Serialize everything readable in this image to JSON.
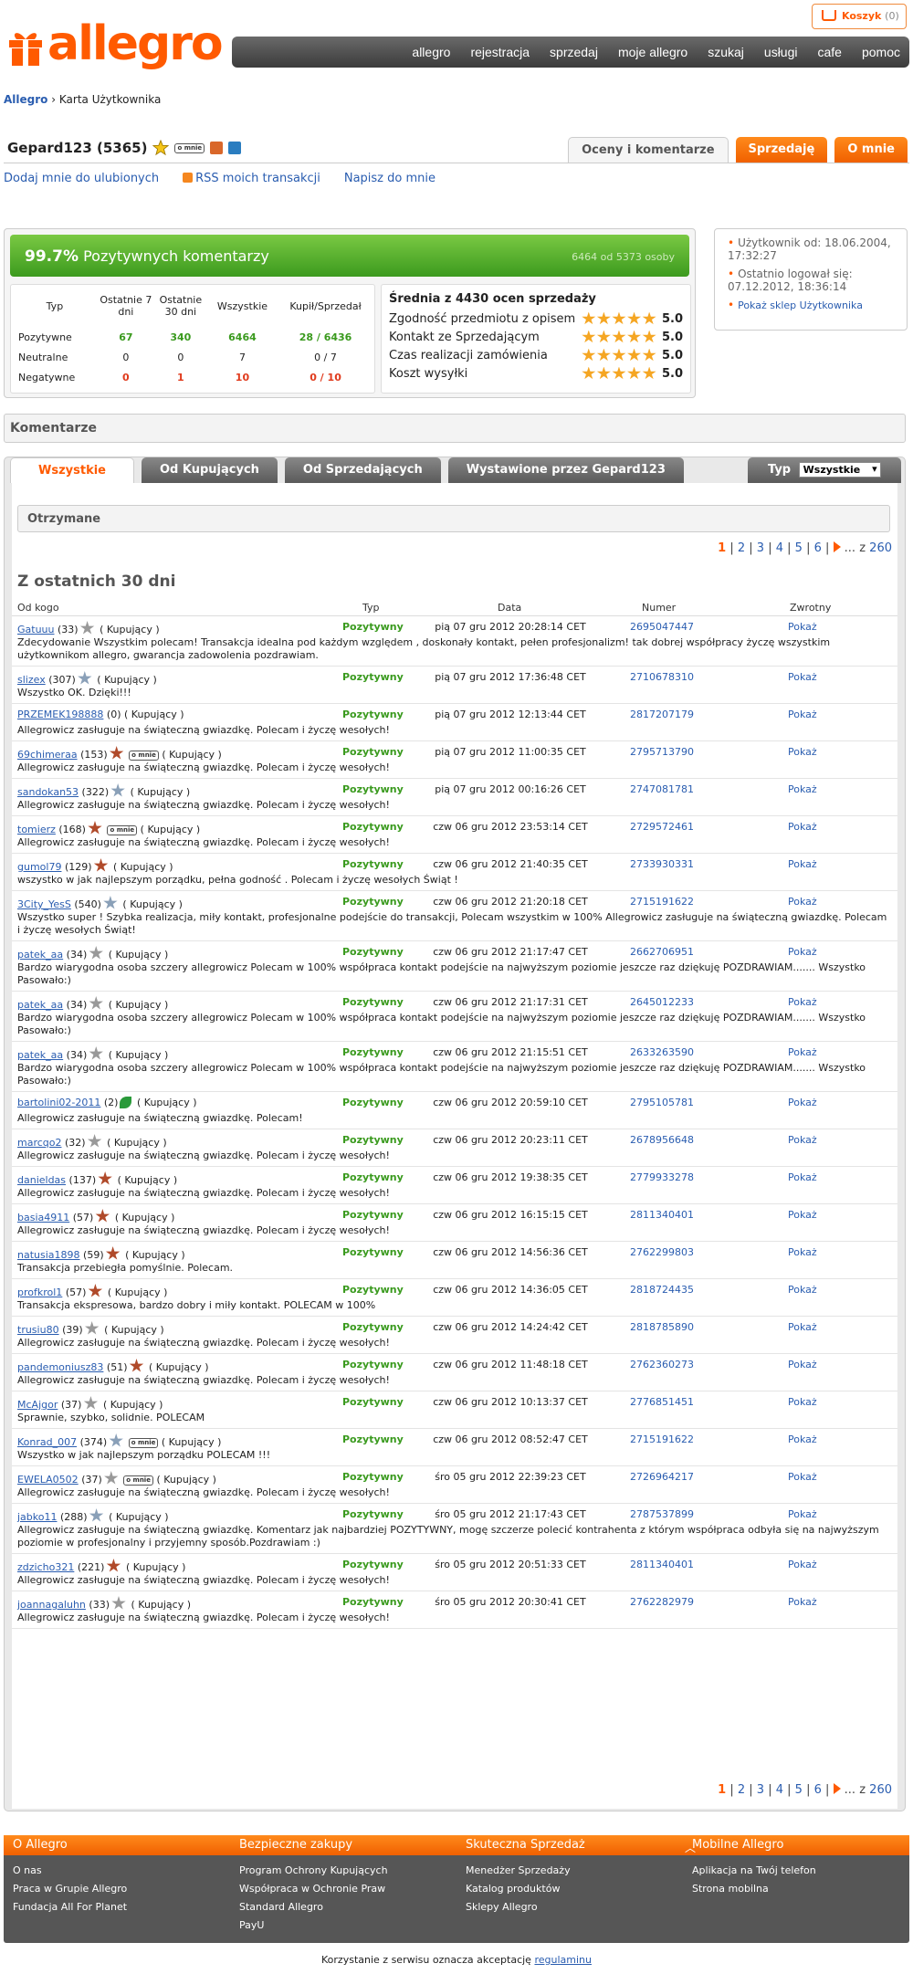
{
  "header": {
    "logo_text": "allegro",
    "cart_label": "Koszyk",
    "cart_count": "(0)",
    "nav": [
      "allegro",
      "rejestracja",
      "sprzedaj",
      "moje allegro",
      "szukaj",
      "usługi",
      "cafe",
      "pomoc"
    ]
  },
  "breadcrumb": {
    "root": "Allegro",
    "sep": "›",
    "current": "Karta Użytkownika"
  },
  "user": {
    "name": "Gepard123 (5365)",
    "omnie_badge": "o mnie"
  },
  "profile_tabs": [
    "Oceny i komentarze",
    "Sprzedaję",
    "O mnie"
  ],
  "links": {
    "fav": "Dodaj mnie do ulubionych",
    "rss": "RSS moich transakcji",
    "write": "Napisz do mnie"
  },
  "rating": {
    "percent": "99.7%",
    "label": "Pozytywnych komentarzy",
    "count_text": "6464 od 5373 osoby",
    "headers": [
      "Typ",
      "Ostatnie 7 dni",
      "Ostatnie 30 dni",
      "Wszystkie",
      "Kupił/Sprzedał"
    ],
    "rows": [
      {
        "type": "Pozytywne",
        "d7": "67",
        "d30": "340",
        "all": "6464",
        "ks": "28 / 6436",
        "cls": "g"
      },
      {
        "type": "Neutralne",
        "d7": "0",
        "d30": "0",
        "all": "7",
        "ks": "0 / 7",
        "cls": ""
      },
      {
        "type": "Negatywne",
        "d7": "0",
        "d30": "1",
        "all": "10",
        "ks": "0 / 10",
        "cls": "r"
      }
    ],
    "avg_title": "Średnia z 4430 ocen sprzedaży",
    "avg": [
      {
        "label": "Zgodność przedmiotu z opisem",
        "value": "5.0"
      },
      {
        "label": "Kontakt ze Sprzedającym",
        "value": "5.0"
      },
      {
        "label": "Czas realizacji zamówienia",
        "value": "5.0"
      },
      {
        "label": "Koszt wysyłki",
        "value": "5.0"
      }
    ],
    "star_color": "#f5a623",
    "green": "#5ab22f"
  },
  "sidebox": {
    "since": "Użytkownik od: 18.06.2004, 17:32:27",
    "lastlogin": "Ostatnio logował się: 07.12.2012, 18:36:14",
    "shop": "Pokaż sklep Użytkownika"
  },
  "comments": {
    "section_title": "Komentarze",
    "tabs": [
      "Wszystkie",
      "Od Kupujących",
      "Od Sprzedających",
      "Wystawione przez Gepard123"
    ],
    "typ_label": "Typ",
    "typ_value": "Wszystkie",
    "subheader": "Otrzymane",
    "pager": {
      "pages": [
        "1",
        "2",
        "3",
        "4",
        "5",
        "6"
      ],
      "dots": "... z",
      "last": "260"
    },
    "period_title": "Z ostatnich 30 dni",
    "columns": [
      "Od kogo",
      "Typ",
      "Data",
      "Numer",
      "Zwrotny"
    ],
    "items": [
      {
        "user": "Gatuuu",
        "score": "(33)",
        "star": "empty",
        "omnie": false,
        "role": "( Kupujący )",
        "type": "Pozytywny",
        "date": "pią 07 gru 2012 20:28:14 CET",
        "num": "2695047447",
        "zw": "Pokaż",
        "text": "Zdecydowanie Wszystkim polecam! Transakcja idealna pod każdym względem , doskonały kontakt, pełen profesjonalizm! tak dobrej współpracy życzę wszystkim użytkownikom allegro, gwarancja zadowolenia pozdrawiam."
      },
      {
        "user": "slizex",
        "score": "(307)",
        "star": "gray",
        "omnie": false,
        "role": "( Kupujący )",
        "type": "Pozytywny",
        "date": "pią 07 gru 2012 17:36:48 CET",
        "num": "2710678310",
        "zw": "Pokaż",
        "text": "Wszystko OK. Dzięki!!!"
      },
      {
        "user": "PRZEMEK198888",
        "score": "(0)",
        "star": "none",
        "omnie": false,
        "role": "( Kupujący )",
        "type": "Pozytywny",
        "date": "pią 07 gru 2012 12:13:44 CET",
        "num": "2817207179",
        "zw": "Pokaż",
        "text": "Allegrowicz zasługuje na świąteczną gwiazdkę. Polecam i życzę wesołych!"
      },
      {
        "user": "69chimeraa",
        "score": "(153)",
        "star": "red",
        "omnie": true,
        "role": "( Kupujący )",
        "type": "Pozytywny",
        "date": "pią 07 gru 2012 11:00:35 CET",
        "num": "2795713790",
        "zw": "Pokaż",
        "text": "Allegrowicz zasługuje na świąteczną gwiazdkę. Polecam i życzę wesołych!"
      },
      {
        "user": "sandokan53",
        "score": "(322)",
        "star": "gray",
        "omnie": false,
        "role": "( Kupujący )",
        "type": "Pozytywny",
        "date": "pią 07 gru 2012 00:16:26 CET",
        "num": "2747081781",
        "zw": "Pokaż",
        "text": "Allegrowicz zasługuje na świąteczną gwiazdkę. Polecam i życzę wesołych!"
      },
      {
        "user": "tomierz",
        "score": "(168)",
        "star": "red",
        "omnie": true,
        "role": "( Kupujący )",
        "type": "Pozytywny",
        "date": "czw 06 gru 2012 23:53:14 CET",
        "num": "2729572461",
        "zw": "Pokaż",
        "text": "Allegrowicz zasługuje na świąteczną gwiazdkę. Polecam i życzę wesołych!"
      },
      {
        "user": "gumol79",
        "score": "(129)",
        "star": "red",
        "omnie": false,
        "role": "( Kupujący )",
        "type": "Pozytywny",
        "date": "czw 06 gru 2012 21:40:35 CET",
        "num": "2733930331",
        "zw": "Pokaż",
        "text": "wszystko w jak najlepszym porządku, pełna godność . Polecam i życzę wesołych Świąt !"
      },
      {
        "user": "3City_YesS",
        "score": "(540)",
        "star": "gray",
        "omnie": false,
        "role": "( Kupujący )",
        "type": "Pozytywny",
        "date": "czw 06 gru 2012 21:20:18 CET",
        "num": "2715191622",
        "zw": "Pokaż",
        "text": "Wszystko super ! Szybka realizacja, miły kontakt, profesjonalne podejście do transakcji, Polecam wszystkim w 100% Allegrowicz zasługuje na świąteczną gwiazdkę. Polecam i życzę wesołych Świąt!"
      },
      {
        "user": "patek_aa",
        "score": "(34)",
        "star": "empty",
        "omnie": false,
        "role": "( Kupujący )",
        "type": "Pozytywny",
        "date": "czw 06 gru 2012 21:17:47 CET",
        "num": "2662706951",
        "zw": "Pokaż",
        "text": "Bardzo wiarygodna osoba szczery allegrowicz Polecam w 100% współpraca kontakt podejście na najwyższym poziomie jeszcze raz dziękuję POZDRAWIAM....... Wszystko Pasowało:)"
      },
      {
        "user": "patek_aa",
        "score": "(34)",
        "star": "empty",
        "omnie": false,
        "role": "( Kupujący )",
        "type": "Pozytywny",
        "date": "czw 06 gru 2012 21:17:31 CET",
        "num": "2645012233",
        "zw": "Pokaż",
        "text": "Bardzo wiarygodna osoba szczery allegrowicz Polecam w 100% współpraca kontakt podejście na najwyższym poziomie jeszcze raz dziękuję POZDRAWIAM....... Wszystko Pasowało:)"
      },
      {
        "user": "patek_aa",
        "score": "(34)",
        "star": "empty",
        "omnie": false,
        "role": "( Kupujący )",
        "type": "Pozytywny",
        "date": "czw 06 gru 2012 21:15:51 CET",
        "num": "2633263590",
        "zw": "Pokaż",
        "text": "Bardzo wiarygodna osoba szczery allegrowicz Polecam w 100% współpraca kontakt podejście na najwyższym poziomie jeszcze raz dziękuję POZDRAWIAM....... Wszystko Pasowało:)"
      },
      {
        "user": "bartolini02-2011",
        "score": "(2)",
        "star": "leaf",
        "omnie": false,
        "role": "( Kupujący )",
        "type": "Pozytywny",
        "date": "czw 06 gru 2012 20:59:10 CET",
        "num": "2795105781",
        "zw": "Pokaż",
        "text": "Allegrowicz zasługuje na świąteczną gwiazdkę. Polecam!"
      },
      {
        "user": "marcqo2",
        "score": "(32)",
        "star": "empty",
        "omnie": false,
        "role": "( Kupujący )",
        "type": "Pozytywny",
        "date": "czw 06 gru 2012 20:23:11 CET",
        "num": "2678956648",
        "zw": "Pokaż",
        "text": "Allegrowicz zasługuje na świąteczną gwiazdkę. Polecam i życzę wesołych!"
      },
      {
        "user": "danieldas",
        "score": "(137)",
        "star": "red",
        "omnie": false,
        "role": "( Kupujący )",
        "type": "Pozytywny",
        "date": "czw 06 gru 2012 19:38:35 CET",
        "num": "2779933278",
        "zw": "Pokaż",
        "text": "Allegrowicz zasługuje na świąteczną gwiazdkę. Polecam i życzę wesołych!"
      },
      {
        "user": "basia4911",
        "score": "(57)",
        "star": "red",
        "omnie": false,
        "role": "( Kupujący )",
        "type": "Pozytywny",
        "date": "czw 06 gru 2012 16:15:15 CET",
        "num": "2811340401",
        "zw": "Pokaż",
        "text": "Allegrowicz zasługuje na świąteczną gwiazdkę. Polecam i życzę wesołych!"
      },
      {
        "user": "natusia1898",
        "score": "(59)",
        "star": "red",
        "omnie": false,
        "role": "( Kupujący )",
        "type": "Pozytywny",
        "date": "czw 06 gru 2012 14:56:36 CET",
        "num": "2762299803",
        "zw": "Pokaż",
        "text": "Transakcja przebiegła pomyślnie. Polecam."
      },
      {
        "user": "profkrol1",
        "score": "(57)",
        "star": "red",
        "omnie": false,
        "role": "( Kupujący )",
        "type": "Pozytywny",
        "date": "czw 06 gru 2012 14:36:05 CET",
        "num": "2818724435",
        "zw": "Pokaż",
        "text": "Transakcja ekspresowa, bardzo dobry i miły kontakt. POLECAM w 100%"
      },
      {
        "user": "trusiu80",
        "score": "(39)",
        "star": "empty",
        "omnie": false,
        "role": "( Kupujący )",
        "type": "Pozytywny",
        "date": "czw 06 gru 2012 14:24:42 CET",
        "num": "2818785890",
        "zw": "Pokaż",
        "text": "Allegrowicz zasługuje na świąteczną gwiazdkę. Polecam i życzę wesołych!"
      },
      {
        "user": "pandemoniusz83",
        "score": "(51)",
        "star": "red",
        "omnie": false,
        "role": "( Kupujący )",
        "type": "Pozytywny",
        "date": "czw 06 gru 2012 11:48:18 CET",
        "num": "2762360273",
        "zw": "Pokaż",
        "text": "Allegrowicz zasługuje na świąteczną gwiazdkę. Polecam i życzę wesołych!"
      },
      {
        "user": "McAjgor",
        "score": "(37)",
        "star": "empty",
        "omnie": false,
        "role": "( Kupujący )",
        "type": "Pozytywny",
        "date": "czw 06 gru 2012 10:13:37 CET",
        "num": "2776851451",
        "zw": "Pokaż",
        "text": "Sprawnie, szybko, solidnie. POLECAM"
      },
      {
        "user": "Konrad_007",
        "score": "(374)",
        "star": "gray",
        "omnie": true,
        "role": "( Kupujący )",
        "type": "Pozytywny",
        "date": "czw 06 gru 2012 08:52:47 CET",
        "num": "2715191622",
        "zw": "Pokaż",
        "text": "Wszystko w jak najlepszym porządku POLECAM !!!"
      },
      {
        "user": "EWELA0502",
        "score": "(37)",
        "star": "empty",
        "omnie": true,
        "role": "( Kupujący )",
        "type": "Pozytywny",
        "date": "śro 05 gru 2012 22:39:23 CET",
        "num": "2726964217",
        "zw": "Pokaż",
        "text": "Allegrowicz zasługuje na świąteczną gwiazdkę. Polecam i życzę wesołych!"
      },
      {
        "user": "jabko11",
        "score": "(288)",
        "star": "gray",
        "omnie": false,
        "role": "( Kupujący )",
        "type": "Pozytywny",
        "date": "śro 05 gru 2012 21:17:43 CET",
        "num": "2787537899",
        "zw": "Pokaż",
        "text": "Allegrowicz zasługuje na świąteczną gwiazdkę. Komentarz jak najbardziej POZYTYWNY, mogę szczerze polecić kontrahenta z którym współpraca odbyła się na najwyższym poziomie w profesjonalny i przyjemny sposób.Pozdrawiam :)"
      },
      {
        "user": "zdzicho321",
        "score": "(221)",
        "star": "red",
        "omnie": false,
        "role": "( Kupujący )",
        "type": "Pozytywny",
        "date": "śro 05 gru 2012 20:51:33 CET",
        "num": "2811340401",
        "zw": "Pokaż",
        "text": "Allegrowicz zasługuje na świąteczną gwiazdkę. Polecam i życzę wesołych!"
      },
      {
        "user": "joannagaluhn",
        "score": "(33)",
        "star": "empty",
        "omnie": false,
        "role": "( Kupujący )",
        "type": "Pozytywny",
        "date": "śro 05 gru 2012 20:30:41 CET",
        "num": "2762282979",
        "zw": "Pokaż",
        "text": "Allegrowicz zasługuje na świąteczną gwiazdkę. Polecam i życzę wesołych!"
      }
    ]
  },
  "footer": {
    "cols": [
      {
        "title": "O Allegro",
        "items": [
          "O nas",
          "Praca w Grupie Allegro",
          "Fundacja All For Planet"
        ]
      },
      {
        "title": "Bezpieczne zakupy",
        "items": [
          "Program Ochrony Kupujących",
          "Współpraca w Ochronie Praw",
          "Standard Allegro",
          "PayU"
        ]
      },
      {
        "title": "Skuteczna Sprzedaż",
        "items": [
          "Menedżer Sprzedaży",
          "Katalog produktów",
          "Sklepy Allegro"
        ]
      },
      {
        "title": "Mobilne Allegro",
        "items": [
          "Aplikacja na Twój telefon",
          "Strona mobilna"
        ]
      }
    ],
    "legal_text": "Korzystanie z serwisu oznacza akceptację",
    "legal_link": "regulaminu"
  }
}
